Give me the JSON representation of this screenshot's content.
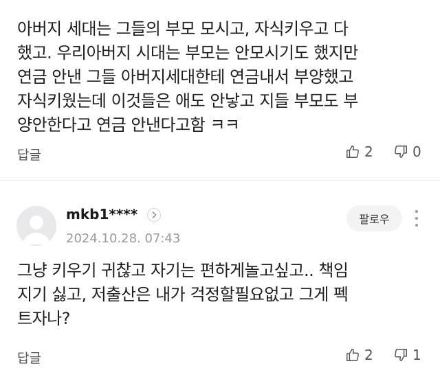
{
  "comment_top": {
    "lines": [
      "아버지 세대는 그들의 부모 모시고, 자식키우고 다",
      "했고. 우리아버지 시대는 부모는 안모시기도 했지만",
      "연금 안낸 그들 아버지세대한테 연금내서 부양했고",
      "자식키웠는데 이것들은 애도 안낳고 지들 부모도 부",
      "양안한다고 연금 안낸다고함 ㅋㅋ"
    ],
    "reply_label": "답글",
    "like_count": "2",
    "dislike_count": "0"
  },
  "comment_bottom": {
    "username": "mkb1****",
    "timestamp": "2024.10.28. 07:43",
    "follow_label": "팔로우",
    "lines": [
      "그냥 키우기 귀찮고 자기는 편하게놀고싶고.. 책임",
      "지기 싫고, 저출산은 내가 걱정할필요없고 그게 펙",
      "트자나?"
    ],
    "reply_label": "답글",
    "like_count": "2",
    "dislike_count": "1"
  },
  "icons": {
    "like": "thumbs-up-icon",
    "dislike": "thumbs-down-icon",
    "more": "vertical-dots-icon",
    "user_arrow": "chevron-right-icon",
    "avatar": "default-avatar-icon"
  },
  "colors": {
    "text": "#1e1e1e",
    "muted": "#9a9a9a",
    "button_bg": "#f3f3f3",
    "divider": "#e8e8e8"
  }
}
